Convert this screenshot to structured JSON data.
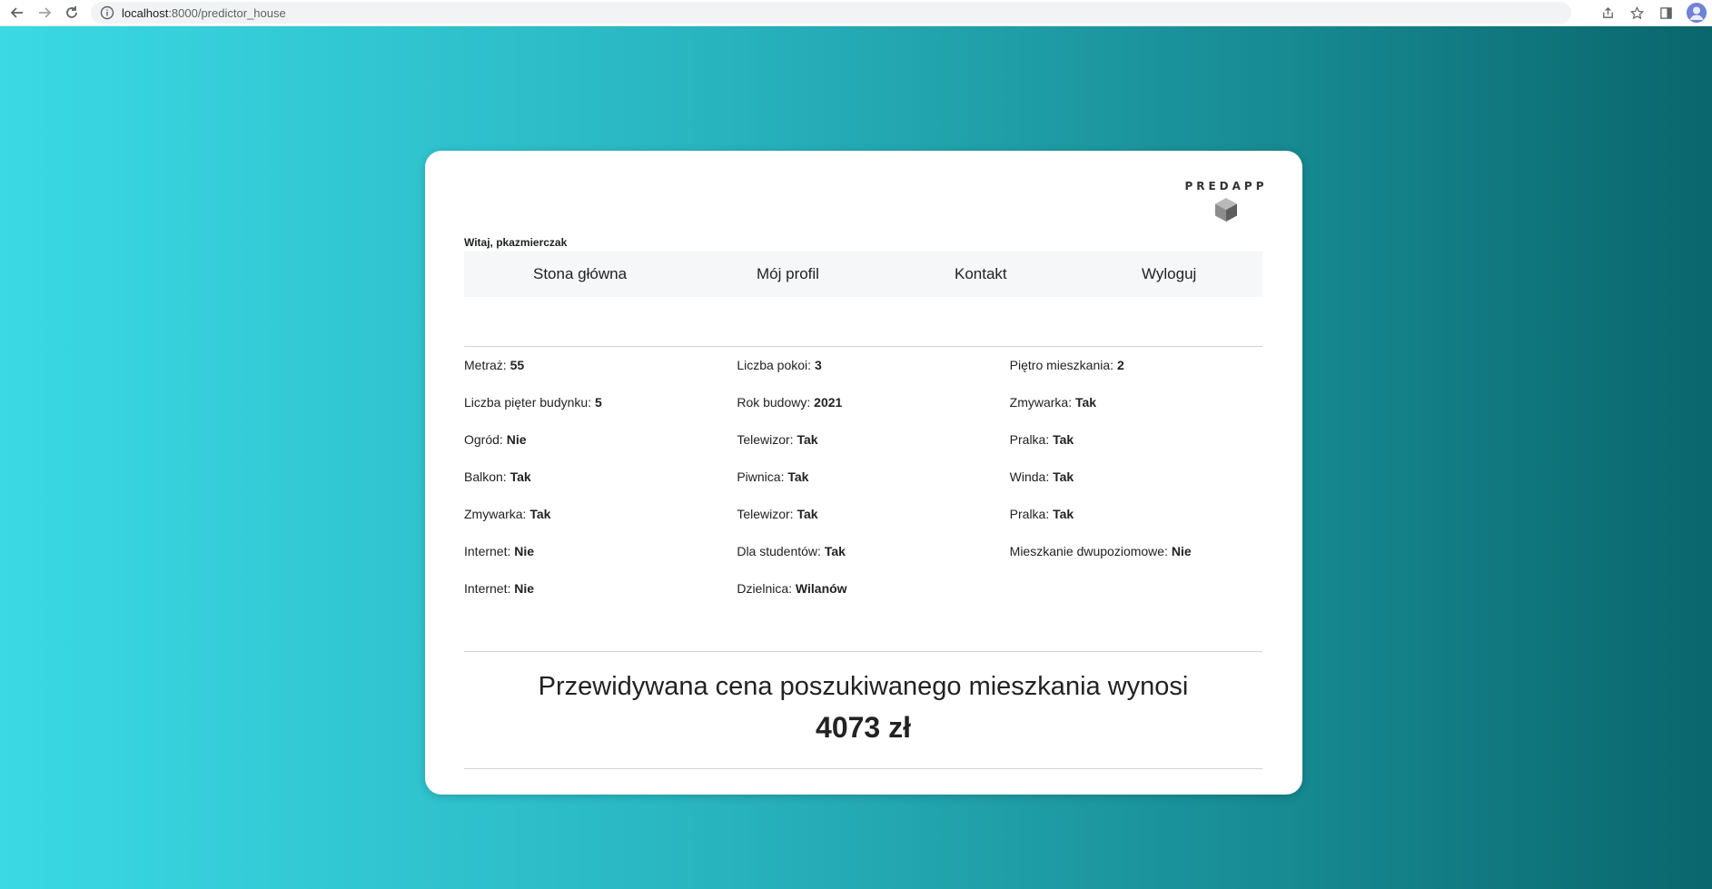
{
  "browser": {
    "url_host": "localhost",
    "url_path": ":8000/predictor_house"
  },
  "logo": {
    "text": "PREDAPP"
  },
  "greeting": "Witaj, pkazmierczak",
  "nav": {
    "items": [
      {
        "label": "Stona główna"
      },
      {
        "label": "Mój profil"
      },
      {
        "label": "Kontakt"
      },
      {
        "label": "Wyloguj"
      }
    ]
  },
  "features": [
    [
      {
        "label": "Metraż:",
        "value": "55"
      },
      {
        "label": "Liczba pokoi:",
        "value": "3"
      },
      {
        "label": "Piętro mieszkania:",
        "value": "2"
      }
    ],
    [
      {
        "label": "Liczba pięter budynku:",
        "value": "5"
      },
      {
        "label": "Rok budowy:",
        "value": "2021"
      },
      {
        "label": "Zmywarka:",
        "value": "Tak"
      }
    ],
    [
      {
        "label": "Ogród:",
        "value": "Nie"
      },
      {
        "label": "Telewizor:",
        "value": "Tak"
      },
      {
        "label": "Pralka:",
        "value": "Tak"
      }
    ],
    [
      {
        "label": "Balkon:",
        "value": "Tak"
      },
      {
        "label": "Piwnica:",
        "value": "Tak"
      },
      {
        "label": "Winda:",
        "value": "Tak"
      }
    ],
    [
      {
        "label": "Zmywarka:",
        "value": "Tak"
      },
      {
        "label": "Telewizor:",
        "value": "Tak"
      },
      {
        "label": "Pralka:",
        "value": "Tak"
      }
    ],
    [
      {
        "label": "Internet:",
        "value": "Nie"
      },
      {
        "label": "Dla studentów:",
        "value": "Tak"
      },
      {
        "label": "Mieszkanie dwupoziomowe:",
        "value": "Nie"
      }
    ],
    [
      {
        "label": "Internet:",
        "value": "Nie"
      },
      {
        "label": "Dzielnica:",
        "value": "Wilanów"
      },
      null
    ]
  ],
  "result": {
    "title": "Przewidywana cena poszukiwanego mieszkania wynosi",
    "value": "4073 zł"
  },
  "colors": {
    "gradient_start": "#3ad9e4",
    "gradient_end": "#0a666d",
    "card": "#ffffff",
    "navbar_bg": "#f6f7f8"
  }
}
